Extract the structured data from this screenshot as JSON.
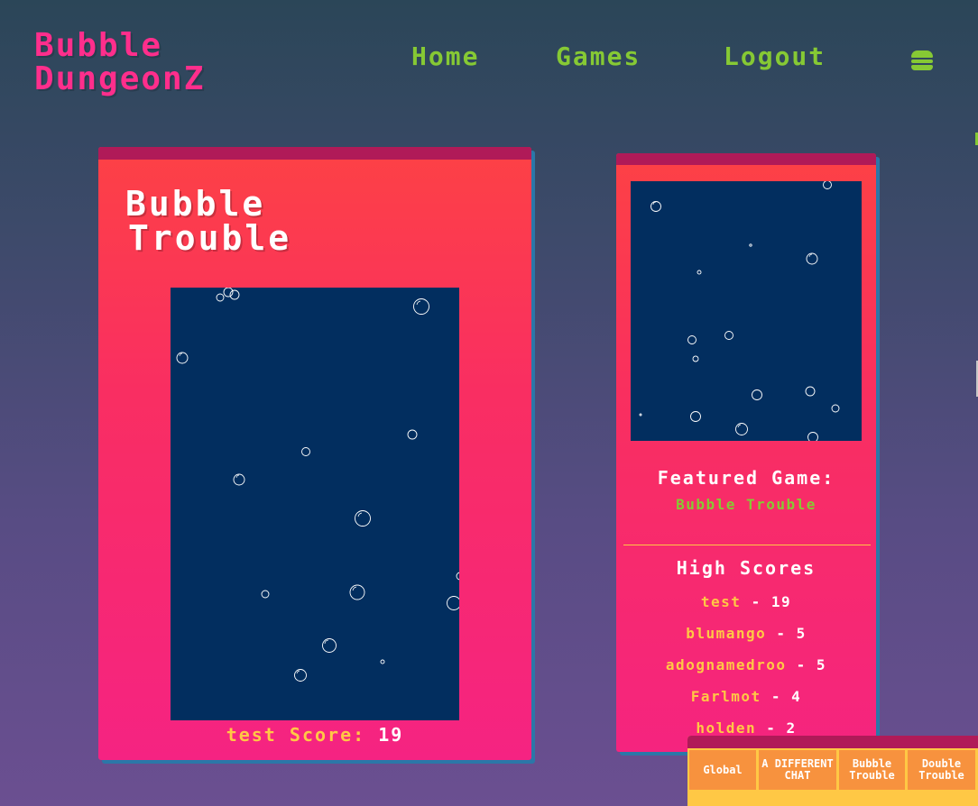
{
  "brand": {
    "line1": "Bubble",
    "line2": "DungeonZ"
  },
  "nav": {
    "home": "Home",
    "games": "Games",
    "logout": "Logout",
    "menu_icon": "hamburger-icon"
  },
  "game": {
    "title_line1": "Bubble",
    "title_line2": "Trouble",
    "player": "test",
    "score_label": "Score:",
    "score_value": "19"
  },
  "sidebar": {
    "featured_label": "Featured Game:",
    "featured_name": "Bubble Trouble",
    "high_scores_title": "High Scores",
    "high_scores": [
      {
        "user": "test",
        "score": "19"
      },
      {
        "user": "blumango",
        "score": "5"
      },
      {
        "user": "adognamedroo",
        "score": "5"
      },
      {
        "user": "Farlmot",
        "score": "4"
      },
      {
        "user": "holden",
        "score": "2"
      }
    ]
  },
  "chat": {
    "tabs": [
      {
        "label": "Global"
      },
      {
        "label": "A DIFFERENT CHAT"
      },
      {
        "label": "Bubble Trouble"
      },
      {
        "label": "Double Trouble"
      }
    ]
  },
  "colors": {
    "brand_pink": "#ff2e8c",
    "nav_green": "#86c934",
    "card_red": "#fd4145",
    "card_pink": "#f52382",
    "canvas_navy": "#022e5f",
    "accent_yellow": "#ffc845",
    "tab_orange": "#f7923e",
    "topbar_maroon": "#b01a58"
  }
}
